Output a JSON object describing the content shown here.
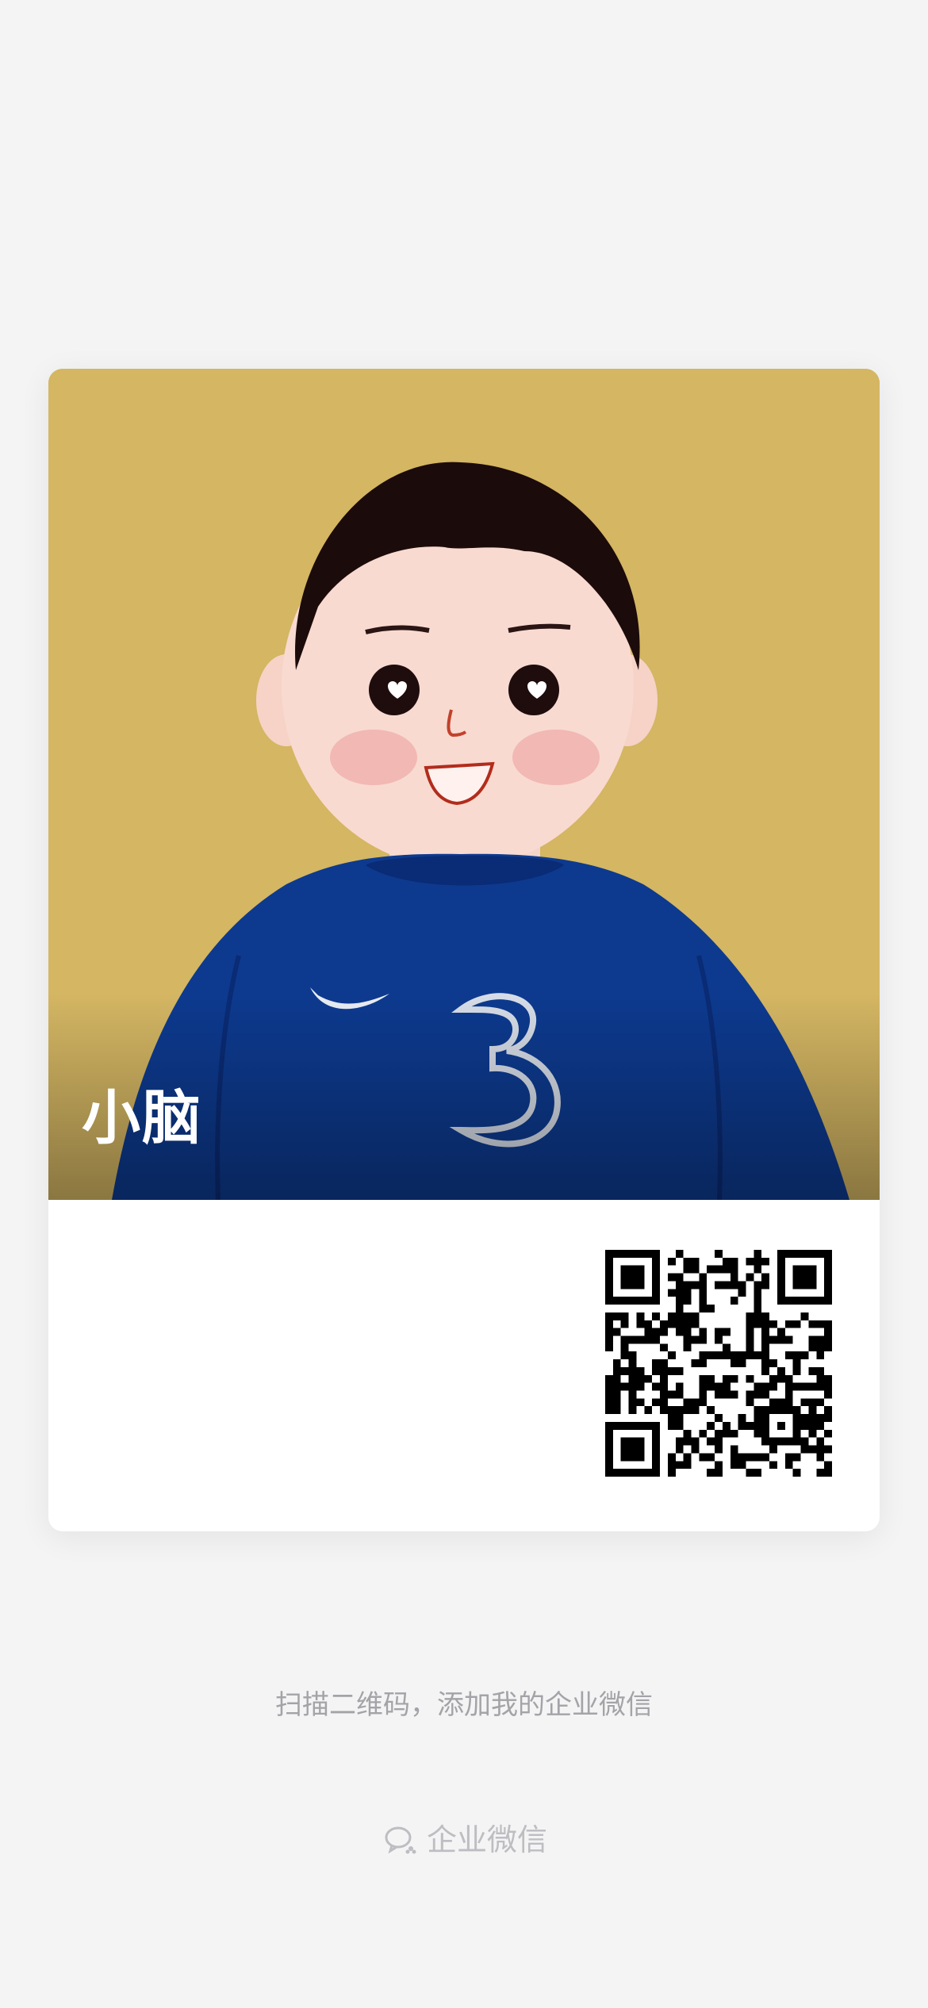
{
  "card": {
    "name": "小脑"
  },
  "hint": "扫描二维码，添加我的企业微信",
  "brand": {
    "icon": "wecom-logo-icon",
    "label": "企业微信"
  },
  "colors": {
    "background": "#f4f4f5",
    "avatar_background": "#d4b663",
    "jersey": "#0d3a8f",
    "hint_text": "#a3a3a8",
    "brand_text": "#bdbdc2"
  }
}
